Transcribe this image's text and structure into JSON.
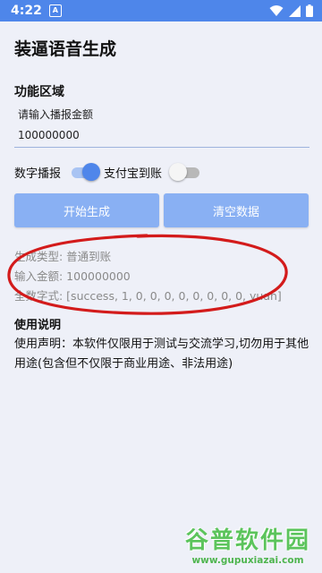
{
  "status": {
    "time": "4:22",
    "notification_glyph": "A",
    "icons": [
      "wifi-icon",
      "signal-icon",
      "battery-icon"
    ]
  },
  "app": {
    "title": "装逼语音生成"
  },
  "function_area": {
    "title": "功能区域",
    "amount_label": "请输入播报金额",
    "amount_value": "100000000"
  },
  "toggles": {
    "digit_label": "数字播报",
    "digit_on": true,
    "alipay_label": "支付宝到账",
    "alipay_on": false
  },
  "buttons": {
    "start": "开始生成",
    "clear": "清空数据"
  },
  "result": {
    "type_line": "生成类型: 普通到账",
    "amount_line": "输入金额: 100000000",
    "digits_line": "全数字式: [success, 1, 0, 0, 0, 0, 0, 0, 0, 0, yuan]"
  },
  "usage": {
    "title": "使用说明",
    "text": "使用声明：本软件仅限用于测试与交流学习,切勿用于其他用途(包含但不仅限于商业用途、非法用途)"
  },
  "watermark": {
    "logo": "谷普软件园",
    "url": "www.gupuxiazai.com"
  },
  "colors": {
    "status_bar": "#4e86ea",
    "button": "#89b0f3",
    "annotation": "#d31b1b",
    "background": "#eef0f8"
  }
}
